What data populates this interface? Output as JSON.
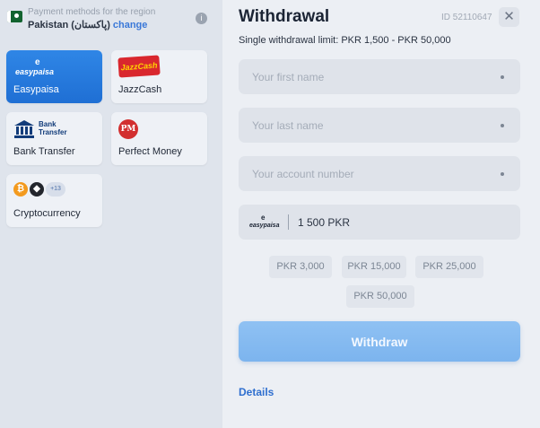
{
  "region": {
    "label": "Payment methods for the region",
    "country": "Pakistan (پاکستان)",
    "change_link": "change",
    "info_icon": "i"
  },
  "methods": [
    {
      "label": "Easypaisa",
      "logo_title": "easypaisa",
      "logo_mark": "e",
      "active": true
    },
    {
      "label": "JazzCash",
      "logo_text": "JazzCash"
    },
    {
      "label": "Bank Transfer",
      "logo_text_1": "Bank",
      "logo_text_2": "Transfer"
    },
    {
      "label": "Perfect Money",
      "logo_text": "PM"
    },
    {
      "label": "Cryptocurrency",
      "more_count": "+13",
      "btc_glyph": "₿",
      "eth_glyph": "◆"
    }
  ],
  "panel": {
    "title": "Withdrawal",
    "user_id": "ID 52110647",
    "close_glyph": "✕",
    "limit_text": "Single withdrawal limit: PKR 1,500 - PKR 50,000",
    "first_name_placeholder": "Your first name",
    "last_name_placeholder": "Your last name",
    "account_placeholder": "Your account number",
    "amount_value": "1 500 PKR",
    "amount_logo_title": "easypaisa",
    "amount_logo_mark": "e",
    "quick_amounts": [
      "PKR 3,000",
      "PKR 15,000",
      "PKR 25,000",
      "PKR 50,000"
    ],
    "withdraw_label": "Withdraw",
    "details_link": "Details"
  },
  "colors": {
    "active_card": "#1f6fd4",
    "withdraw_button": "#7cb4ee",
    "link": "#2f6fcf"
  }
}
